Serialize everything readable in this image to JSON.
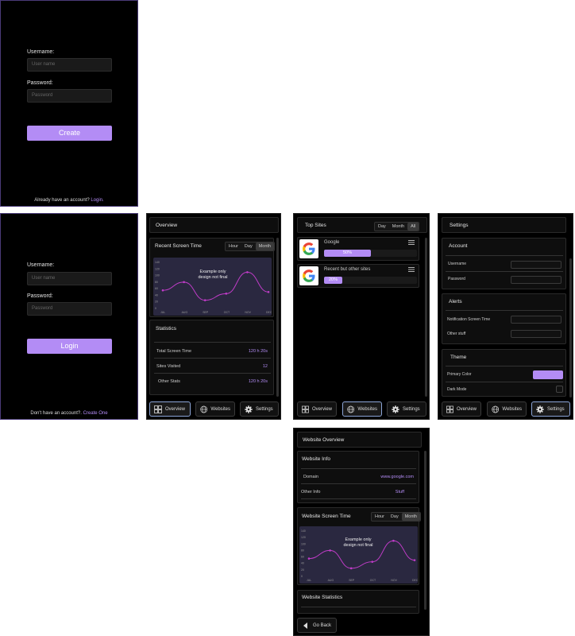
{
  "create_screen": {
    "username_label": "Username:",
    "username_placeholder": "User name",
    "password_label": "Password:",
    "password_placeholder": "Password",
    "button": "Create",
    "footer_text": "Already have an account? ",
    "footer_link": "Login."
  },
  "login_screen": {
    "username_label": "Username:",
    "username_placeholder": "User name",
    "password_label": "Password:",
    "password_placeholder": "Password",
    "button": "Login",
    "footer_text": "Don't have an account?. ",
    "footer_link": "Create One"
  },
  "nav": {
    "overview": "Overview",
    "websites": "Websites",
    "settings": "Settings"
  },
  "overview_screen": {
    "header": "Overview",
    "recent_title": "Recent Screen Time",
    "range": [
      "Hour",
      "Day",
      "Month"
    ],
    "chart_note": "Example only design not final",
    "statistics_title": "Statistics",
    "stats": [
      {
        "label": "Total Screen Time",
        "value": "120 h 20s"
      },
      {
        "label": "Sites Visited",
        "value": "12"
      },
      {
        "label": "Other Stats",
        "value": "120 h 20s"
      }
    ]
  },
  "chart_data": {
    "type": "line",
    "x": [
      "JUL",
      "AUG",
      "SEP",
      "OCT",
      "NOV",
      "DEC"
    ],
    "y_ticks": [
      "140",
      "120",
      "100",
      "80",
      "60",
      "40",
      "20",
      "0"
    ],
    "values": [
      55,
      80,
      25,
      45,
      110,
      50
    ],
    "ylim": [
      0,
      140
    ]
  },
  "websites_screen": {
    "header": "Top Sites",
    "range": [
      "Day",
      "Month",
      "All"
    ],
    "sites": [
      {
        "name": "Google",
        "percent": "50%",
        "fraction": 0.5
      },
      {
        "name": "Recent but other sites",
        "percent": "20%",
        "fraction": 0.2
      }
    ]
  },
  "settings_screen": {
    "header": "Settings",
    "account_title": "Account",
    "account_fields": [
      "Username",
      "Password"
    ],
    "alerts_title": "Alerts",
    "alerts_fields": [
      "Notification Screen Time",
      "Other stuff"
    ],
    "theme_title": "Theme",
    "primary_color_label": "Primary Color",
    "dark_mode_label": "Dark Mode",
    "accent": "#b38cf5"
  },
  "website_overview_screen": {
    "header": "Website Overview",
    "info_title": "Website Info",
    "info": [
      {
        "label": "Domain",
        "value": "www.google.com"
      },
      {
        "label": "Other Info",
        "value": "Stuff"
      }
    ],
    "screen_time_title": "Website Screen Time",
    "range": [
      "Hour",
      "Day",
      "Month"
    ],
    "chart_note": "Example only design not final",
    "statistics_title": "Website Statistics",
    "back": "Go Back"
  }
}
